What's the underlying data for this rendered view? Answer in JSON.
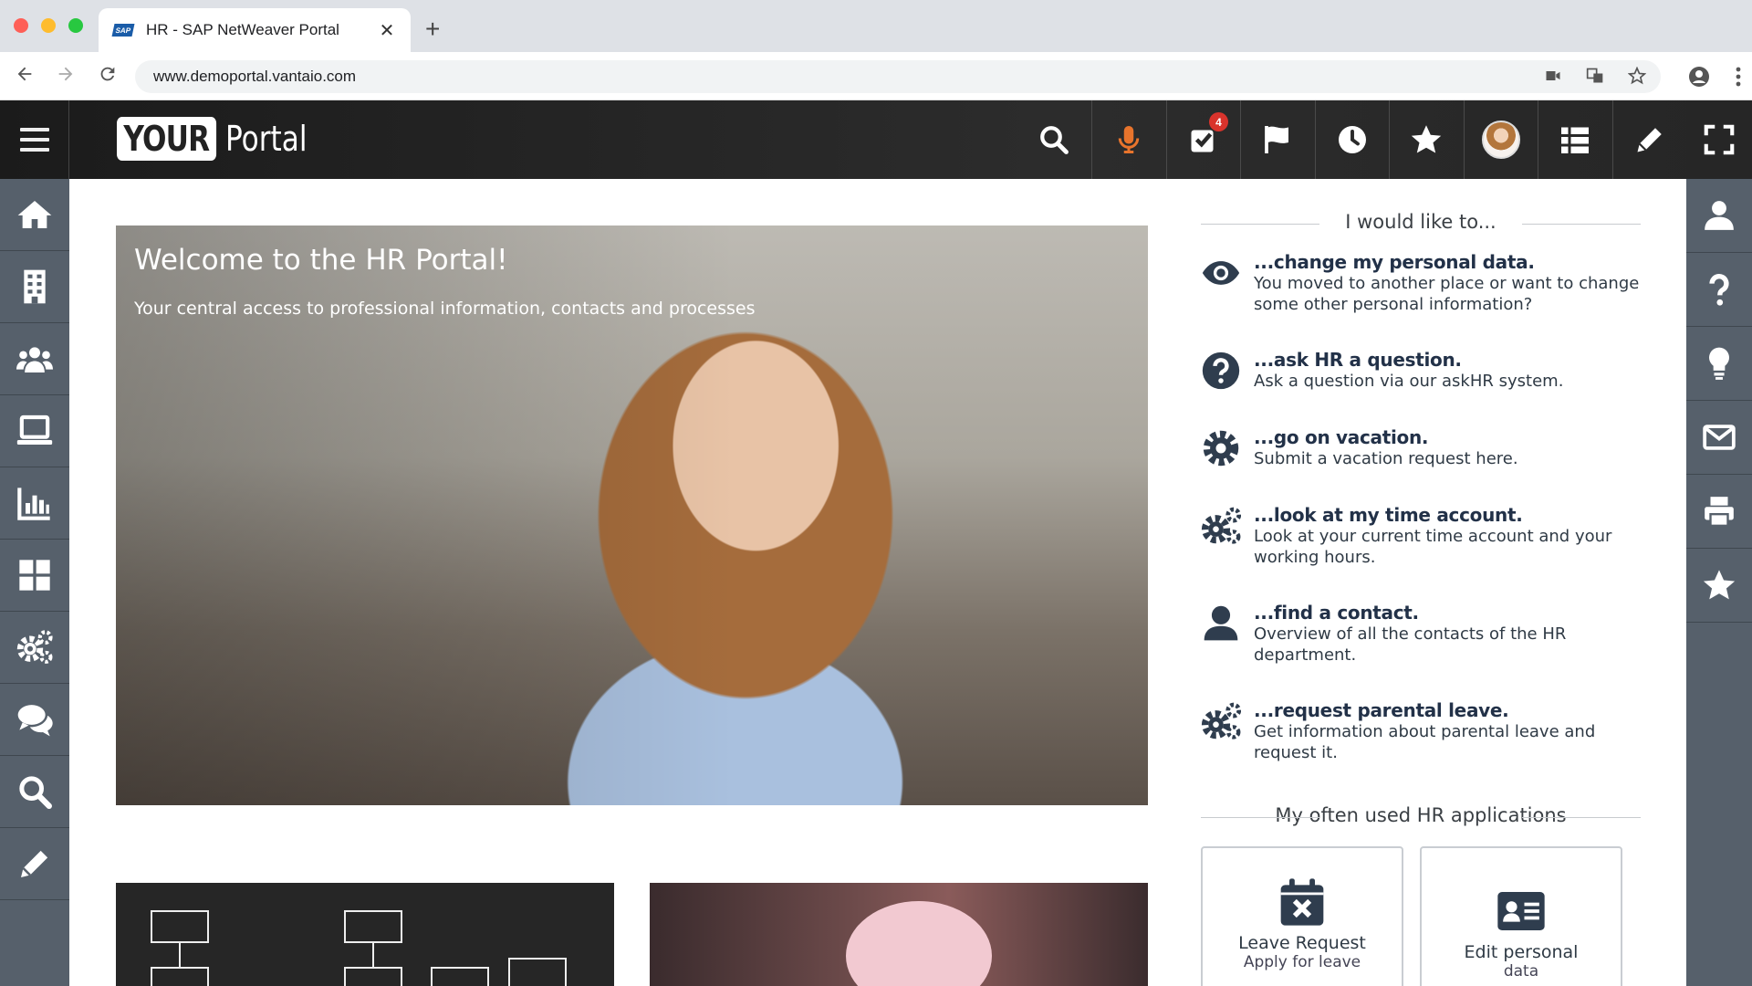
{
  "browser": {
    "tab_title": "HR - SAP NetWeaver Portal",
    "tab_favicon": "SAP",
    "url": "www.demoportal.vantaio.com",
    "traffic_colors": [
      "#fe5f57",
      "#febc2e",
      "#28c840"
    ]
  },
  "header": {
    "logo_your": "YOUR",
    "logo_portal": "Portal",
    "tasks_badge": "4",
    "icons": [
      "search-icon",
      "microphone-icon",
      "tasks-icon",
      "flag-icon",
      "clock-icon",
      "star-icon",
      "avatar",
      "list-icon",
      "pencil-icon",
      "fullscreen-icon"
    ],
    "mic_color": "#e8742c"
  },
  "left_nav": [
    "home-icon",
    "building-icon",
    "team-icon",
    "laptop-icon",
    "chart-icon",
    "tiles-icon",
    "settings-icon",
    "chat-icon",
    "search-icon",
    "edit-icon"
  ],
  "right_nav": [
    "user-icon",
    "help-icon",
    "idea-icon",
    "mail-icon",
    "print-icon",
    "favorite-icon"
  ],
  "hero": {
    "title": "Welcome to the HR Portal!",
    "subtitle": "Your central access to professional information, contacts and processes"
  },
  "panel": {
    "heading": "I would like to...",
    "items": [
      {
        "icon": "eye-icon",
        "title": "...change my personal data.",
        "desc": "You moved to another place or want to change some other personal information?"
      },
      {
        "icon": "question-icon",
        "title": "...ask HR a question.",
        "desc": "Ask a question via our askHR system."
      },
      {
        "icon": "gear-icon",
        "title": "...go on vacation.",
        "desc": "Submit a vacation request here."
      },
      {
        "icon": "gears-icon",
        "title": "...look at my time account.",
        "desc": "Look at your current time account and your working hours."
      },
      {
        "icon": "person-icon",
        "title": "...find a contact.",
        "desc": "Overview of all the contacts of the HR department."
      },
      {
        "icon": "gears-icon",
        "title": "...request parental leave.",
        "desc": "Get information about parental leave and request it."
      }
    ],
    "apps_heading": "My often used HR applications",
    "apps": [
      {
        "icon": "calendar-x-icon",
        "title": "Leave Request",
        "subtitle": "Apply for leave"
      },
      {
        "icon": "id-card-icon",
        "title": "Edit personal",
        "subtitle": "data"
      }
    ]
  }
}
